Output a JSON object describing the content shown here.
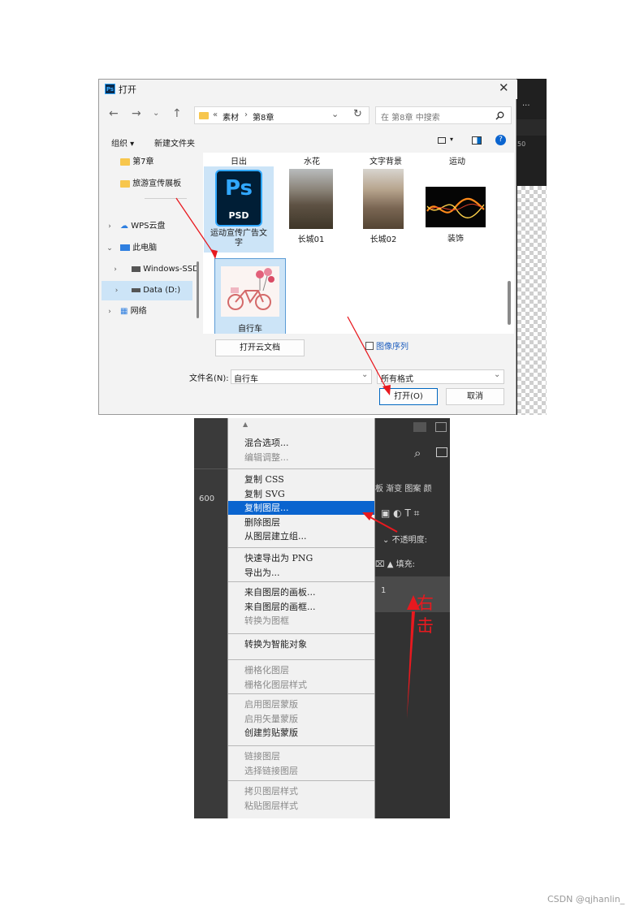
{
  "dialog": {
    "title": "打开",
    "app_badge": "Ps",
    "breadcrumb": [
      "«",
      "素材",
      "›",
      "第8章"
    ],
    "search_placeholder": "在 第8章 中搜索",
    "toolbar": {
      "organize": "组织 ▾",
      "new_folder": "新建文件夹"
    },
    "sidebar": [
      {
        "label": "第7章",
        "type": "folder"
      },
      {
        "label": "旅游宣传展板",
        "type": "folder"
      },
      {
        "label": "WPS云盘",
        "type": "cloud"
      },
      {
        "label": "此电脑",
        "type": "pc"
      },
      {
        "label": "Windows-SSD",
        "type": "drive"
      },
      {
        "label": "Data (D:)",
        "type": "drive",
        "selected": true
      },
      {
        "label": "网络",
        "type": "network"
      }
    ],
    "column_headers": [
      "日出",
      "水花",
      "文字背景",
      "运动"
    ],
    "files": [
      {
        "name": "运动宣传广告文字",
        "kind": "psd",
        "icon_text": "Ps",
        "icon_sub": "PSD"
      },
      {
        "name": "长城01",
        "kind": "photo"
      },
      {
        "name": "长城02",
        "kind": "photo"
      },
      {
        "name": "装饰",
        "kind": "photo"
      },
      {
        "name": "自行车",
        "kind": "image",
        "selected": true
      }
    ],
    "cloud_doc_button": "打开云文档",
    "image_sequence": "图像序列",
    "filename_label": "文件名(N):",
    "filename_value": "自行车",
    "filetype_value": "所有格式",
    "open_button": "打开(O)",
    "cancel_button": "取消",
    "bg_ruler": "50",
    "bg_dots": "···"
  },
  "ps_bg": {
    "ruler": "600",
    "panel_tabs": [
      "板",
      "渐变",
      "图案",
      "颜"
    ],
    "opacity_label": "不透明度:",
    "fill_label": "填充:",
    "layer_num": "1"
  },
  "context_menu": {
    "groups": [
      [
        {
          "label": "混合选项...",
          "enabled": true
        },
        {
          "label": "编辑调整...",
          "enabled": false
        }
      ],
      [
        {
          "label": "复制 CSS",
          "enabled": true
        },
        {
          "label": "复制 SVG",
          "enabled": true
        },
        {
          "label": "复制图层...",
          "enabled": true,
          "highlighted": true
        },
        {
          "label": "删除图层",
          "enabled": true
        },
        {
          "label": "从图层建立组...",
          "enabled": true
        }
      ],
      [
        {
          "label": "快速导出为 PNG",
          "enabled": true
        },
        {
          "label": "导出为...",
          "enabled": true
        }
      ],
      [
        {
          "label": "来自图层的画板...",
          "enabled": true
        },
        {
          "label": "来自图层的画框...",
          "enabled": true
        },
        {
          "label": "转换为图框",
          "enabled": false
        }
      ],
      [
        {
          "label": "转换为智能对象",
          "enabled": true
        }
      ],
      [
        {
          "label": "栅格化图层",
          "enabled": false
        },
        {
          "label": "栅格化图层样式",
          "enabled": false
        }
      ],
      [
        {
          "label": "启用图层蒙版",
          "enabled": false
        },
        {
          "label": "启用矢量蒙版",
          "enabled": false
        },
        {
          "label": "创建剪贴蒙版",
          "enabled": true
        }
      ],
      [
        {
          "label": "链接图层",
          "enabled": false
        },
        {
          "label": "选择链接图层",
          "enabled": false
        }
      ],
      [
        {
          "label": "拷贝图层样式",
          "enabled": false
        },
        {
          "label": "粘贴图层样式",
          "enabled": false
        }
      ]
    ]
  },
  "annotation": {
    "right_click_1": "右",
    "right_click_2": "击"
  },
  "footer": "CSDN @qjhanlin_",
  "colors": {
    "highlight": "#0a64cf",
    "annotation": "#e8191f",
    "ps_blue": "#31a8ff"
  }
}
